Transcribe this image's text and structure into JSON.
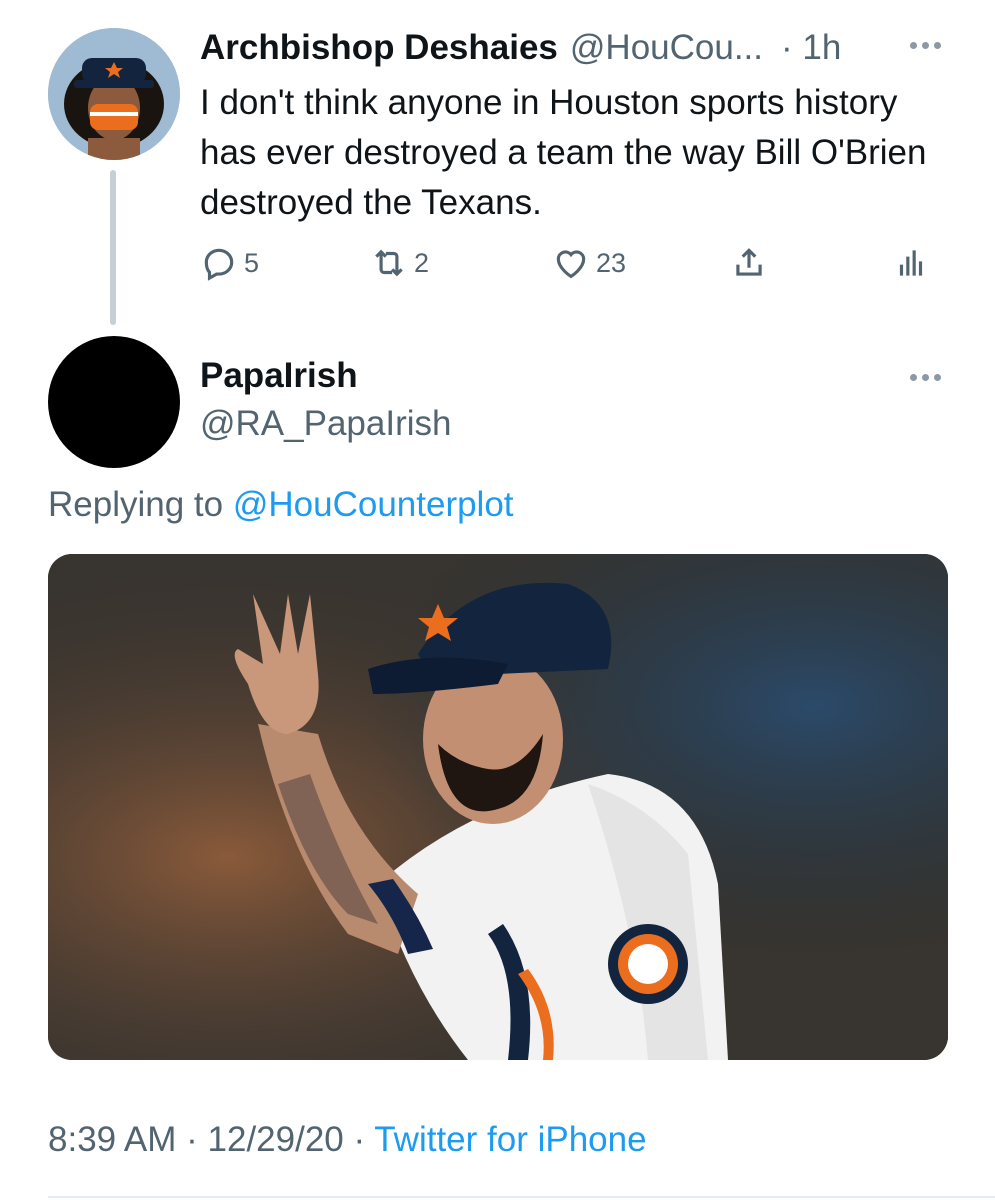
{
  "parent_tweet": {
    "display_name": "Archbishop Deshaies",
    "handle": "@HouCou...",
    "time": "· 1h",
    "text": "I don't think anyone in Houston sports history has ever destroyed a team the way Bill O'Brien destroyed the Texans.",
    "replies": "5",
    "retweets": "2",
    "likes": "23"
  },
  "reply_tweet": {
    "display_name": "PapaIrish",
    "handle": "@RA_PapaIrish",
    "replying_prefix": "Replying to",
    "replying_to": "@HouCounterplot",
    "timestamp": "8:39 AM · 12/29/20 · ",
    "source": "Twitter for iPhone"
  },
  "icons": {
    "reply": "reply-icon",
    "retweet": "retweet-icon",
    "like": "heart-icon",
    "share": "share-icon",
    "analytics": "analytics-icon",
    "more": "more-icon"
  },
  "colors": {
    "link": "#1d9bf0",
    "secondary_text": "#536471",
    "primary_text": "#0f1419"
  }
}
